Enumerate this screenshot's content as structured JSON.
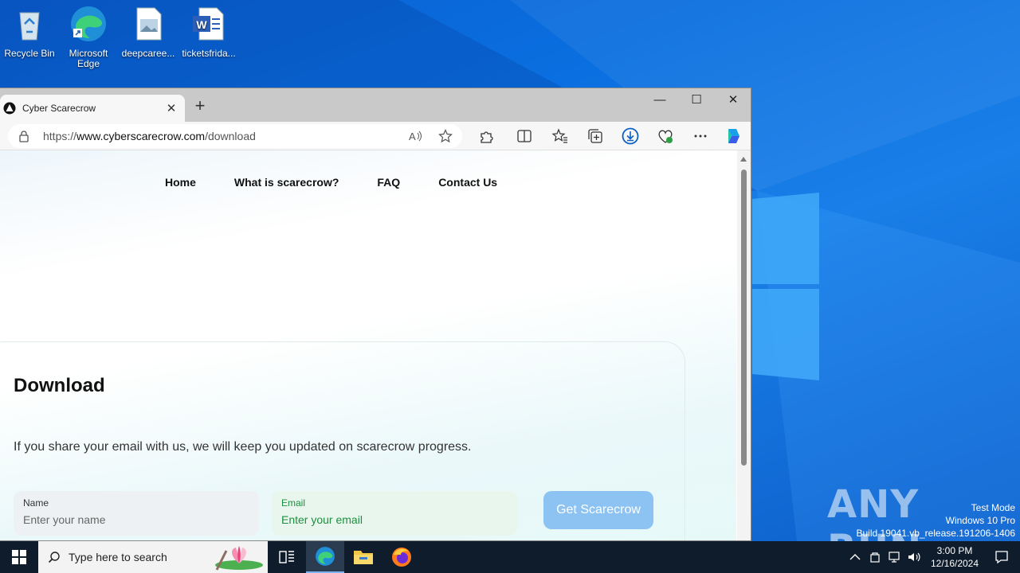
{
  "desktop": {
    "icons": [
      {
        "label": "Recycle Bin"
      },
      {
        "label": "Microsoft Edge"
      },
      {
        "label": "deepcaree..."
      },
      {
        "label": "ticketsfrida..."
      }
    ],
    "watermark": {
      "line1": "Test Mode",
      "line2": "Windows 10 Pro",
      "line3": "Build 19041.vb_release.191206-1406"
    },
    "brand": "ANY RUN"
  },
  "browser": {
    "tab_title": "Cyber Scarecrow",
    "url_prefix": "https://",
    "url_host": "www.cyberscarecrow.com",
    "url_path": "/download"
  },
  "page": {
    "nav": [
      "Home",
      "What is scarecrow?",
      "FAQ",
      "Contact Us"
    ],
    "heading": "Download",
    "description": "If you share your email with us, we will keep you updated on scarecrow progress.",
    "name_label": "Name",
    "name_placeholder": "Enter your name",
    "email_label": "Email",
    "email_placeholder": "Enter your email",
    "button_label": "Get Scarecrow"
  },
  "taskbar": {
    "search_placeholder": "Type here to search",
    "time": "3:00 PM",
    "date": "12/16/2024"
  },
  "colors": {
    "desktop_blue": "#0a6fe0",
    "button_blue": "#8cc3f2",
    "email_green": "#1e8e3e"
  }
}
